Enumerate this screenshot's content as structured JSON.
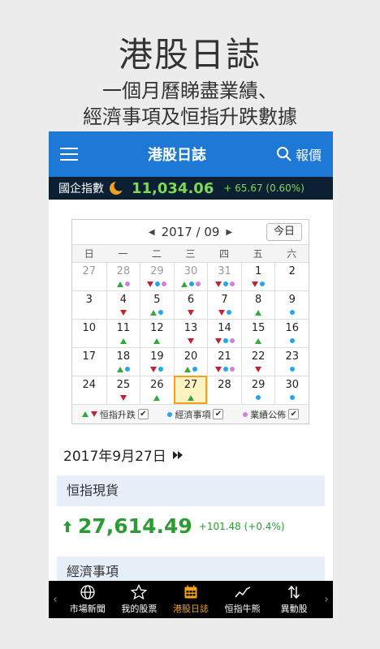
{
  "promo": {
    "title": "港股日誌",
    "line1": "一個月曆睇盡業績、",
    "line2": "經濟事項及恒指升跌數據"
  },
  "appbar": {
    "title": "港股日誌",
    "quote_label": "報價"
  },
  "ticker": {
    "name": "國企指數",
    "price": "11,034.06",
    "change": "+ 65.67  (0.60%)",
    "color": "#7ed957"
  },
  "calendar": {
    "month_label": "2017 / 09",
    "today_label": "今日",
    "weekdays": [
      "日",
      "一",
      "二",
      "三",
      "四",
      "五",
      "六"
    ],
    "days": [
      {
        "d": "27",
        "muted": true,
        "m": []
      },
      {
        "d": "28",
        "muted": true,
        "m": [
          "up",
          "p"
        ]
      },
      {
        "d": "29",
        "muted": true,
        "m": [
          "down",
          "b",
          "p"
        ]
      },
      {
        "d": "30",
        "muted": true,
        "m": [
          "up",
          "b",
          "p"
        ]
      },
      {
        "d": "31",
        "muted": true,
        "m": [
          "down",
          "b",
          "p"
        ]
      },
      {
        "d": "1",
        "m": [
          "down",
          "b"
        ]
      },
      {
        "d": "2",
        "m": []
      },
      {
        "d": "3",
        "m": []
      },
      {
        "d": "4",
        "m": [
          "down"
        ]
      },
      {
        "d": "5",
        "m": [
          "up",
          "b"
        ]
      },
      {
        "d": "6",
        "m": [
          "down"
        ]
      },
      {
        "d": "7",
        "m": [
          "down",
          "b"
        ]
      },
      {
        "d": "8",
        "m": [
          "up"
        ]
      },
      {
        "d": "9",
        "m": [
          "b"
        ]
      },
      {
        "d": "10",
        "m": []
      },
      {
        "d": "11",
        "m": [
          "up"
        ]
      },
      {
        "d": "12",
        "m": [
          "up"
        ]
      },
      {
        "d": "13",
        "m": [
          "down"
        ]
      },
      {
        "d": "14",
        "m": [
          "down",
          "b",
          "p"
        ]
      },
      {
        "d": "15",
        "m": [
          "up"
        ]
      },
      {
        "d": "16",
        "m": [
          "b"
        ]
      },
      {
        "d": "17",
        "m": []
      },
      {
        "d": "18",
        "m": [
          "up",
          "b"
        ]
      },
      {
        "d": "19",
        "m": [
          "down",
          "b"
        ]
      },
      {
        "d": "20",
        "m": [
          "up",
          "b"
        ]
      },
      {
        "d": "21",
        "m": [
          "down",
          "b",
          "p"
        ]
      },
      {
        "d": "22",
        "m": [
          "down"
        ]
      },
      {
        "d": "23",
        "m": [
          "b"
        ]
      },
      {
        "d": "24",
        "m": []
      },
      {
        "d": "25",
        "m": [
          "down"
        ]
      },
      {
        "d": "26",
        "m": [
          "up"
        ]
      },
      {
        "d": "27",
        "m": [
          "up"
        ],
        "selected": true
      },
      {
        "d": "28",
        "m": []
      },
      {
        "d": "29",
        "m": [
          "b"
        ]
      },
      {
        "d": "30",
        "m": [
          "b"
        ]
      }
    ],
    "legend": {
      "hsi": "恒指升跌",
      "econ": "經濟事項",
      "results": "業績公佈"
    },
    "colors": {
      "up": "#35a83c",
      "down": "#c8202d",
      "econ": "#23a6ee",
      "results": "#d17fe0",
      "selected": "#f4a21d"
    }
  },
  "selected_date": "2017年9月27日",
  "hsi_section": {
    "title": "恒指現貨",
    "price": "27,614.49",
    "change": "+101.48 (+0.4%)"
  },
  "econ_section": {
    "title": "經濟事項"
  },
  "tabbar": {
    "tabs": [
      {
        "label": "市場新聞",
        "icon": "globe-icon"
      },
      {
        "label": "我的股票",
        "icon": "star-icon"
      },
      {
        "label": "港股日誌",
        "icon": "calendar-icon",
        "active": true
      },
      {
        "label": "恒指牛熊",
        "icon": "trend-icon"
      },
      {
        "label": "異動股",
        "icon": "updown-icon"
      }
    ]
  }
}
